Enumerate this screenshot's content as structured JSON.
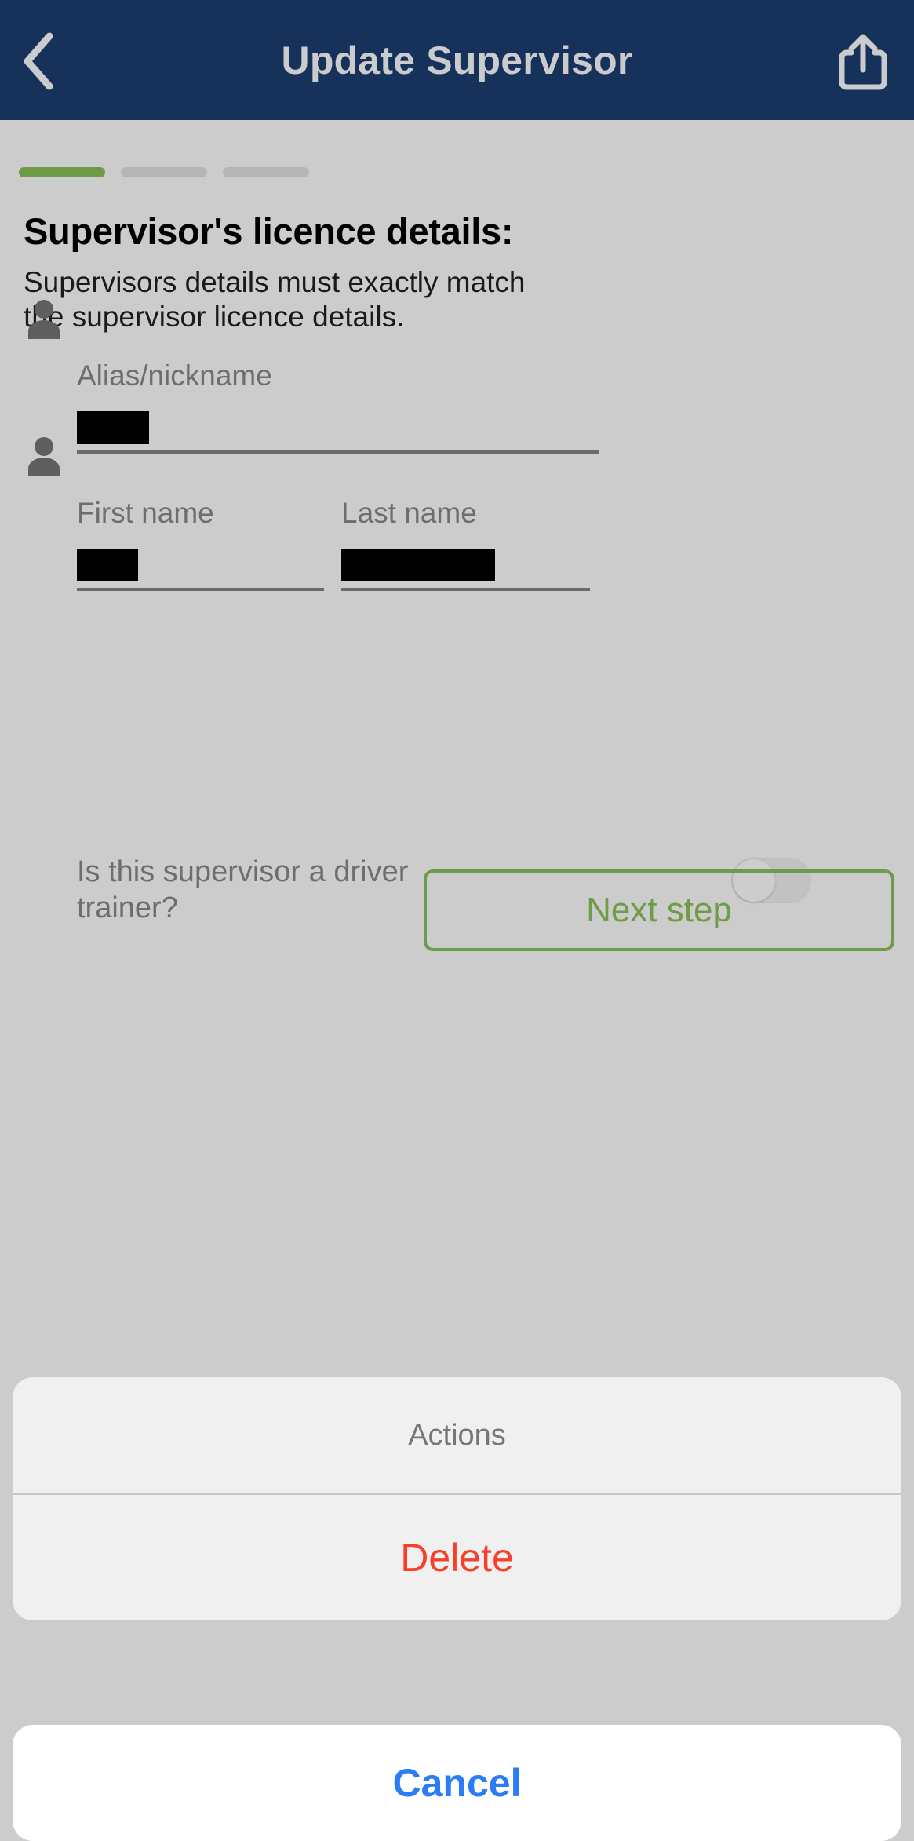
{
  "header": {
    "title": "Update Supervisor",
    "back_icon": "chevron-left-icon",
    "share_icon": "share-icon",
    "background_color": "#16315a",
    "text_color": "#c9cbcd"
  },
  "progress": {
    "steps": [
      {
        "state": "active"
      },
      {
        "state": "inactive"
      },
      {
        "state": "inactive"
      }
    ],
    "active_color": "#6c9a45",
    "inactive_color": "#b6b6b6"
  },
  "page": {
    "title": "Supervisor's licence details:",
    "subtitle": "Supervisors details must exactly match the supervisor licence details."
  },
  "form": {
    "alias": {
      "label": "Alias/nickname",
      "value": "",
      "redacted": true,
      "icon": "person-icon"
    },
    "first_name": {
      "label": "First name",
      "value": "",
      "redacted": true,
      "icon": "person-icon"
    },
    "last_name": {
      "label": "Last name",
      "value": "",
      "redacted": true
    },
    "driver_trainer": {
      "label": "Is this supervisor a driver trainer?",
      "state": "off"
    }
  },
  "actions": {
    "next_step_label": "Next step",
    "next_step_color": "#6f9c47"
  },
  "action_sheet": {
    "header": "Actions",
    "items": [
      {
        "label": "Delete",
        "style": "destructive",
        "color": "#f6402c"
      }
    ],
    "cancel_label": "Cancel",
    "cancel_color": "#2b7cf6"
  }
}
